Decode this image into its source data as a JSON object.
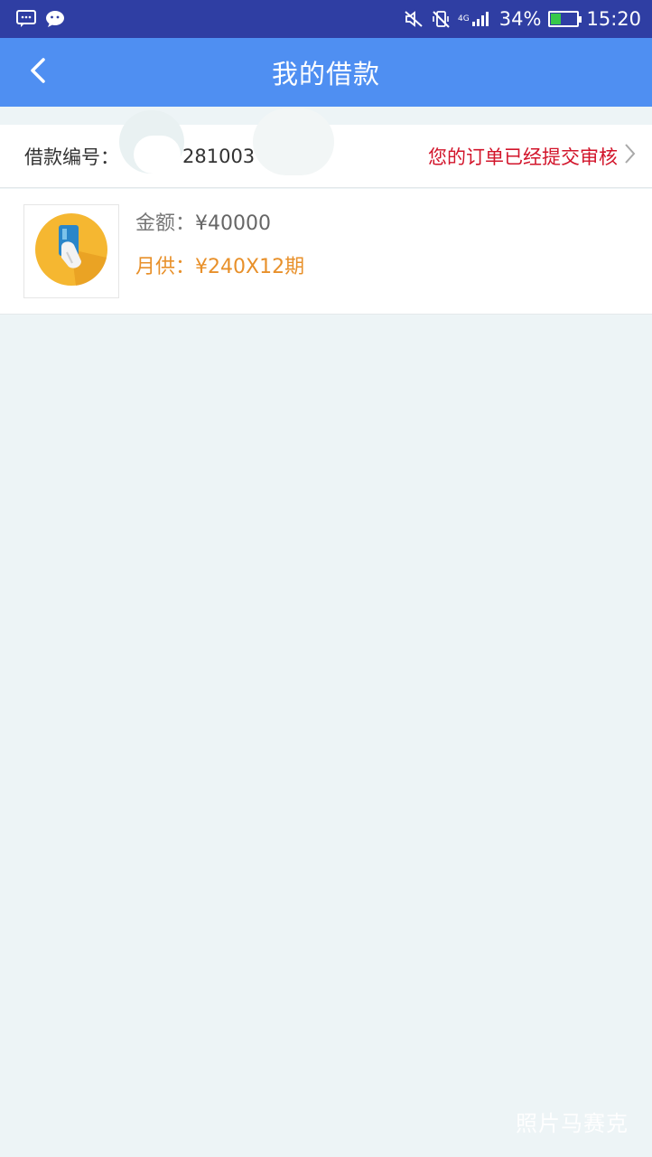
{
  "status_bar": {
    "battery_percent": "34%",
    "battery_level": 0.34,
    "time": "15:20",
    "signal_text": "4G",
    "icons": [
      "message-icon",
      "wechat-icon",
      "mute-icon",
      "vibrate-off-icon",
      "signal-icon",
      "battery-icon"
    ]
  },
  "app_bar": {
    "title": "我的借款",
    "back_icon": "chevron-left-icon"
  },
  "order": {
    "label": "借款编号：",
    "number": "281003",
    "status": "您的订单已经提交审核"
  },
  "item": {
    "amount_label": "金额：",
    "amount_value": "¥40000",
    "monthly_label": "月供：",
    "monthly_value": "¥240X12期"
  },
  "watermark": "照片马赛克",
  "colors": {
    "status_bar": "#2f3ea3",
    "app_bar": "#4f8ff2",
    "background": "#edf4f6",
    "status_text": "#d2142a",
    "monthly_text": "#e8902a"
  }
}
